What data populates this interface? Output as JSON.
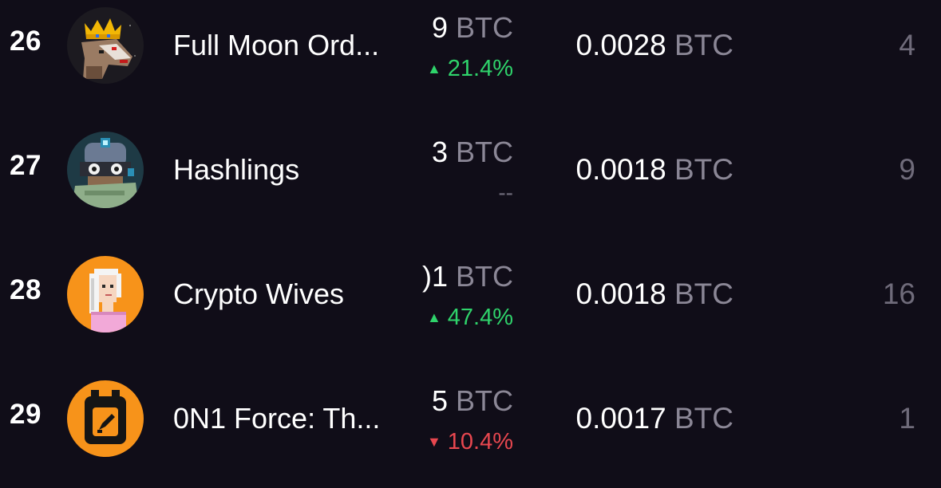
{
  "unit": "BTC",
  "rows": [
    {
      "rank": "26",
      "avatar": "wolf-king-avatar",
      "name": "Full Moon Ord...",
      "volume": "9",
      "volume_unit": "BTC",
      "change": "21.4%",
      "direction": "up",
      "floor": "0.0028",
      "floor_unit": "BTC",
      "count": "4"
    },
    {
      "rank": "27",
      "avatar": "goggles-robot-avatar",
      "name": "Hashlings",
      "volume": "3",
      "volume_unit": "BTC",
      "change": "--",
      "direction": "none",
      "floor": "0.0018",
      "floor_unit": "BTC",
      "count": "9"
    },
    {
      "rank": "28",
      "avatar": "crypto-wife-avatar",
      "name": "Crypto Wives",
      "volume": ")1",
      "volume_unit": "BTC",
      "change": "47.4%",
      "direction": "up",
      "floor": "0.0018",
      "floor_unit": "BTC",
      "count": "16"
    },
    {
      "rank": "29",
      "avatar": "orange-device-avatar",
      "name": "0N1 Force: Th...",
      "volume": "5",
      "volume_unit": "BTC",
      "change": "10.4%",
      "direction": "down",
      "floor": "0.0017",
      "floor_unit": "BTC",
      "count": "1"
    }
  ],
  "colors": {
    "background": "#100d18",
    "positive": "#2fd36b",
    "negative": "#e8474f",
    "muted": "#8b8796",
    "avatar_orange": "#f7931a"
  }
}
